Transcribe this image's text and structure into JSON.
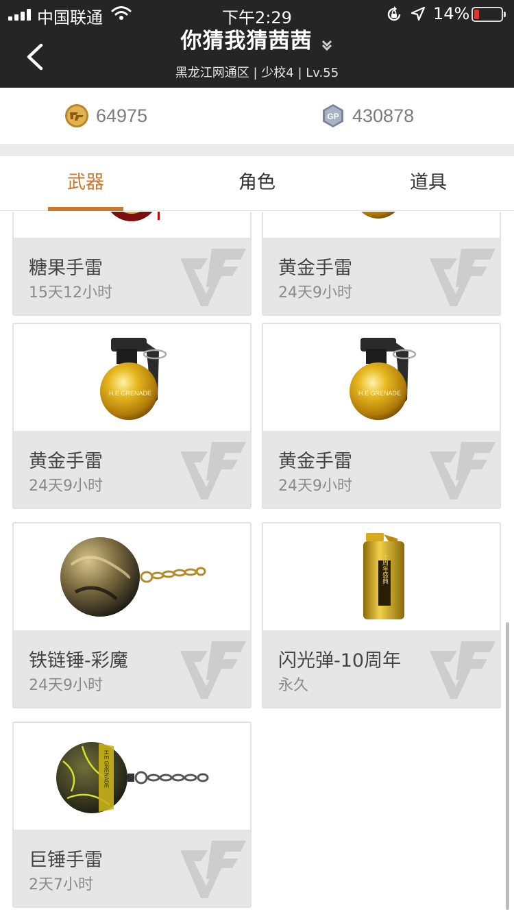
{
  "status_bar": {
    "carrier": "中国联通",
    "time": "下午2:29",
    "battery": "14%"
  },
  "header": {
    "title": "你猜我猜茜茜",
    "subtitle": "黑龙江网通区 | 少校4 | Lv.55"
  },
  "currency": {
    "coins": "64975",
    "gp": "430878",
    "gp_badge": "GP"
  },
  "tabs": [
    {
      "label": "武器",
      "active": true
    },
    {
      "label": "角色",
      "active": false
    },
    {
      "label": "道具",
      "active": false
    }
  ],
  "items": [
    {
      "name": "糖果手雷",
      "duration": "15天12小时",
      "icon": "candy-grenade-icon"
    },
    {
      "name": "黄金手雷",
      "duration": "24天9小时",
      "icon": "gold-grenade-icon"
    },
    {
      "name": "黄金手雷",
      "duration": "24天9小时",
      "icon": "gold-grenade-icon"
    },
    {
      "name": "黄金手雷",
      "duration": "24天9小时",
      "icon": "gold-grenade-icon"
    },
    {
      "name": "铁链锤-彩魔",
      "duration": "24天9小时",
      "icon": "chain-hammer-grenade-icon"
    },
    {
      "name": "闪光弹-10周年",
      "duration": "永久",
      "icon": "flashbang-10th-anniversary-icon",
      "icon_text": "十周年盛典"
    },
    {
      "name": "巨锤手雷",
      "duration": "2天7小时",
      "icon": "giant-hammer-grenade-icon",
      "icon_text": "H.E GRENADE"
    }
  ],
  "grenade_label": "H.E GRENADE",
  "colors": {
    "header_bg": "#252525",
    "accent": "#c8792f",
    "card_info_bg": "#e6e6e6",
    "battery_low": "#ff3b30"
  }
}
